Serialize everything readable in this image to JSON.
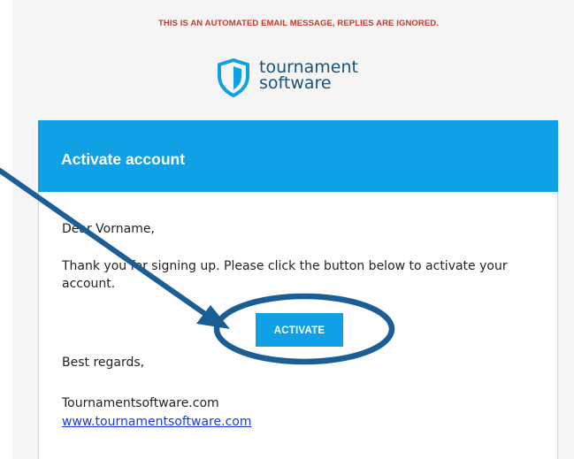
{
  "notice": "THIS IS AN AUTOMATED EMAIL MESSAGE, REPLIES ARE IGNORED.",
  "logo": {
    "line1": "tournament",
    "line2": "software",
    "icon": "shield-icon"
  },
  "card": {
    "title": "Activate account",
    "greeting": "Dear Vorname,",
    "message": "Thank you for signing up. Please click the button below to activate your account.",
    "button_label": "ACTIVATE",
    "regards": "Best regards,",
    "signature": "Tournamentsoftware.com",
    "link_text": "www.tournamentsoftware.com"
  },
  "annotation": {
    "type": "arrow-and-ellipse",
    "color": "#1b5e96"
  },
  "colors": {
    "accent": "#0fa0e6",
    "notice": "#c23a2b",
    "brand": "#17537a",
    "link": "#1a3cd6"
  }
}
